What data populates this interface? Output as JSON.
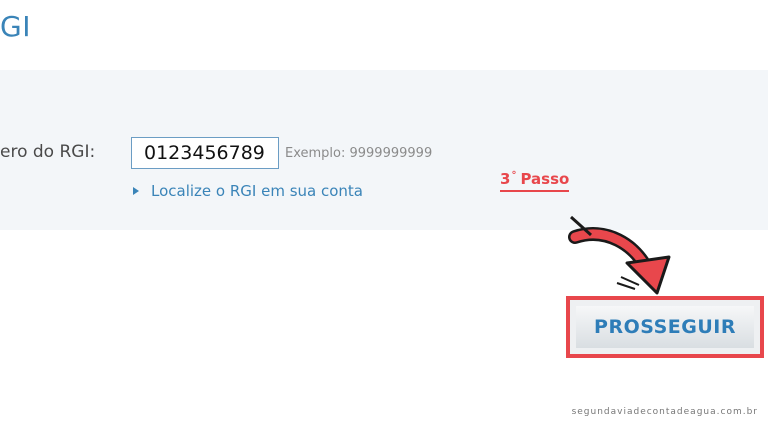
{
  "page": {
    "heading": "GI"
  },
  "form": {
    "field_label": "ero do RGI:",
    "rgi_value": "0123456789",
    "example": "Exemplo: 9999999999",
    "locate_link": "Localize o RGI em sua conta"
  },
  "annotation": {
    "step_number": "3",
    "step_degree": "°",
    "step_word": "Passo",
    "color": "#e8474c"
  },
  "actions": {
    "proceed_label": "PROSSEGUIR"
  },
  "footer": {
    "watermark": "segundaviadecontadeagua.com.br"
  },
  "icons": {
    "link_bullet": "triangle-right-icon",
    "pointer": "curved-arrow-icon"
  }
}
